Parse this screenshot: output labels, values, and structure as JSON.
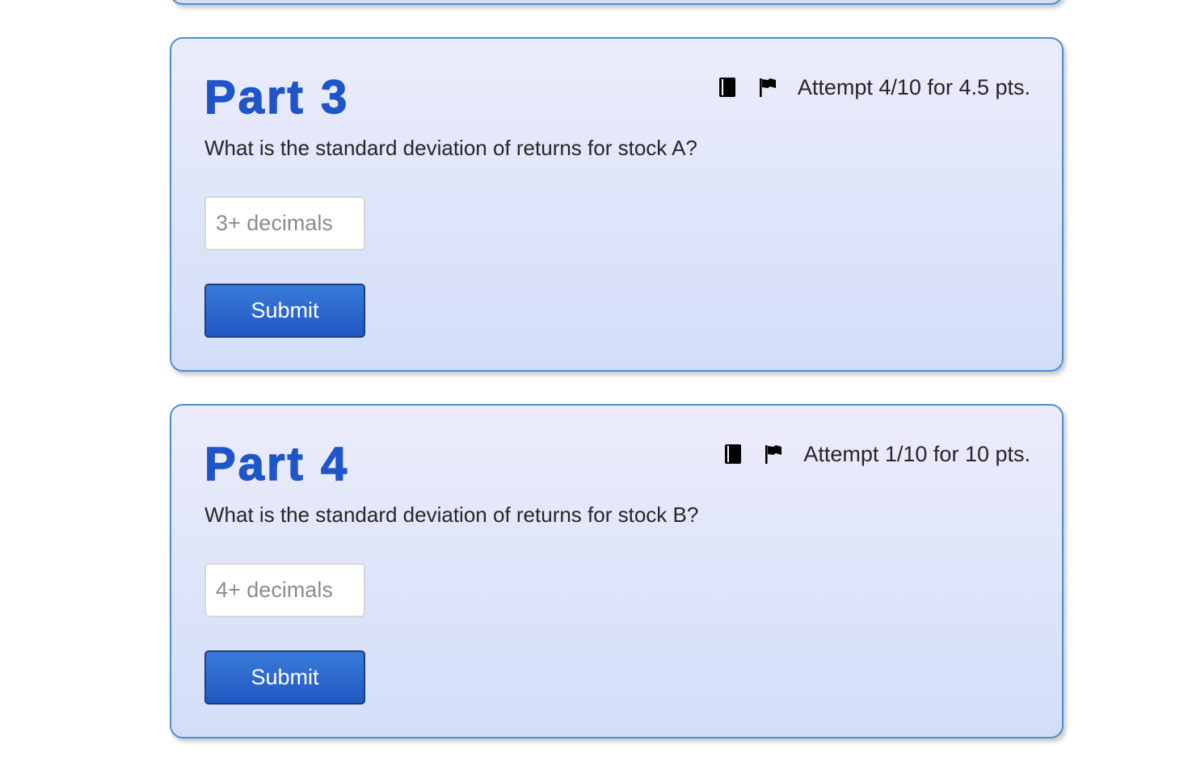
{
  "parts": [
    {
      "title": "Part 3",
      "attempt": "Attempt 4/10 for 4.5 pts.",
      "question": "What is the standard deviation of returns for stock A?",
      "input_placeholder": "3+ decimals",
      "input_value": "",
      "submit_label": "Submit",
      "icons": [
        "book-icon",
        "flag-icon"
      ]
    },
    {
      "title": "Part 4",
      "attempt": "Attempt 1/10 for 10 pts.",
      "question": "What is the standard deviation of returns for stock B?",
      "input_placeholder": "4+ decimals",
      "input_value": "",
      "submit_label": "Submit",
      "icons": [
        "book-icon",
        "flag-icon"
      ]
    }
  ],
  "colors": {
    "title": "#1e55c8",
    "card_border": "#4a8fd4",
    "button": "#1f58c2"
  }
}
